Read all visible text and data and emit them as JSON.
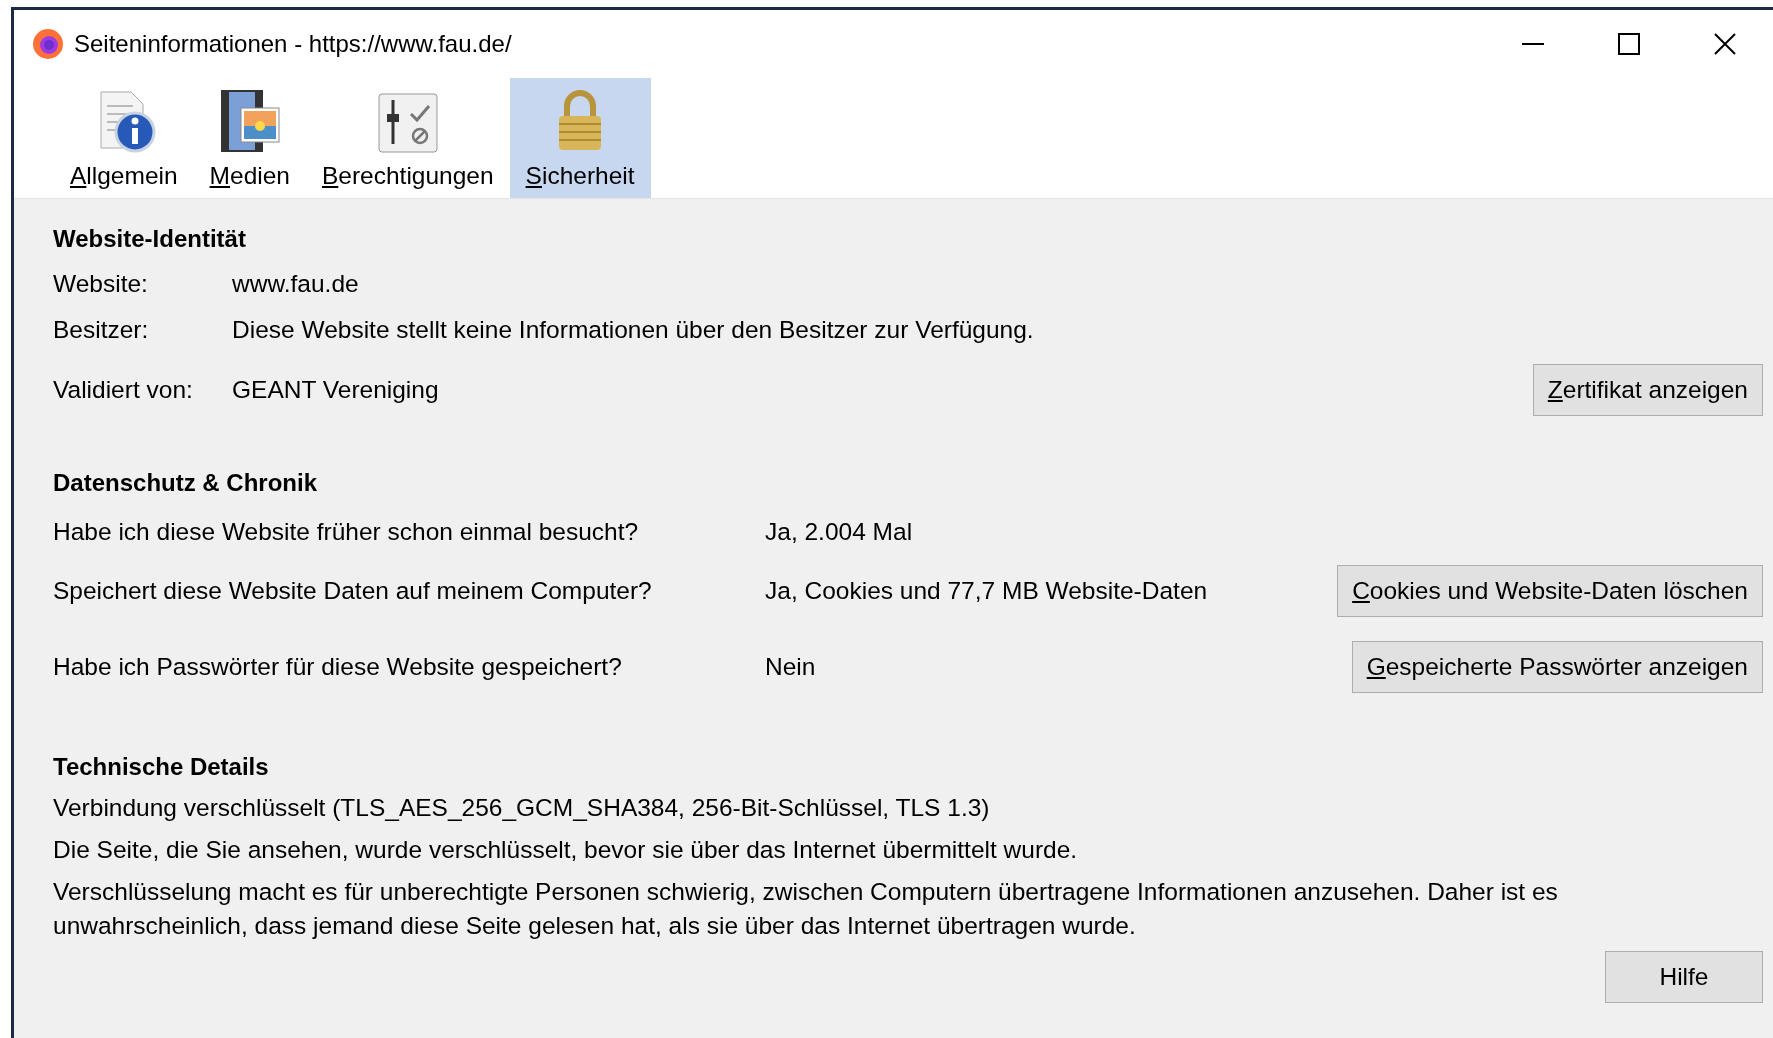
{
  "window": {
    "title": "Seiteninformationen - https://www.fau.de/"
  },
  "tabs": [
    {
      "label": "Allgemein",
      "kind": "info",
      "selected": false
    },
    {
      "label": "Medien",
      "kind": "media",
      "selected": false
    },
    {
      "label": "Berechtigungen",
      "kind": "permissions",
      "selected": false
    },
    {
      "label": "Sicherheit",
      "kind": "lock",
      "selected": true
    }
  ],
  "identity": {
    "title": "Website-Identität",
    "rows": [
      {
        "label": "Website:",
        "value": "www.fau.de"
      },
      {
        "label": "Besitzer:",
        "value": "Diese Website stellt keine Informationen über den Besitzer zur Verfügung."
      },
      {
        "label": "Validiert von:",
        "value": "GEANT Vereniging",
        "button": {
          "label": "Zertifikat anzeigen",
          "mnemonic": true
        }
      }
    ]
  },
  "privacy": {
    "title": "Datenschutz & Chronik",
    "rows": [
      {
        "question": "Habe ich diese Website früher schon einmal besucht?",
        "answer": "Ja, 2.004 Mal"
      },
      {
        "question": "Speichert diese Website Daten auf meinem Computer?",
        "answer": "Ja, Cookies und 77,7 MB Website-Daten",
        "button": {
          "label": "Cookies und Website-Daten löschen",
          "mnemonic": true
        }
      },
      {
        "question": "Habe ich Passwörter für diese Website gespeichert?",
        "answer": "Nein",
        "button": {
          "label": "Gespeicherte Passwörter anzeigen",
          "mnemonic": true
        }
      }
    ]
  },
  "technical": {
    "title": "Technische Details",
    "lines": [
      "Verbindung verschlüsselt (TLS_AES_256_GCM_SHA384, 256-Bit-Schlüssel, TLS 1.3)",
      "Die Seite, die Sie ansehen, wurde verschlüsselt, bevor sie über das Internet übermittelt wurde.",
      "Verschlüsselung macht es für unberechtigte Personen schwierig, zwischen Computern übertragene Informationen anzusehen. Daher ist es unwahrscheinlich, dass jemand diese Seite gelesen hat, als sie über das Internet übertragen wurde."
    ]
  },
  "help_button": {
    "label": "Hilfe",
    "mnemonic": false
  }
}
